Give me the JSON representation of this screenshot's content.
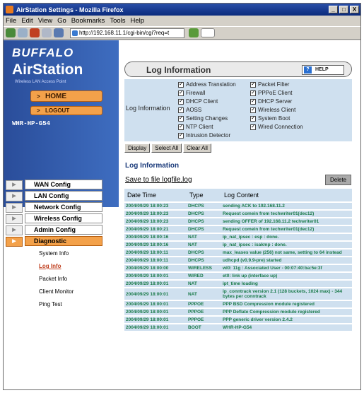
{
  "window": {
    "title": "AirStation Settings - Mozilla Firefox",
    "btn_min": "_",
    "btn_max": "□",
    "btn_close": "X"
  },
  "menu": [
    {
      "label": "File",
      "u": "F"
    },
    {
      "label": "Edit",
      "u": "E"
    },
    {
      "label": "View",
      "u": "V"
    },
    {
      "label": "Go",
      "u": "G"
    },
    {
      "label": "Bookmarks",
      "u": "B"
    },
    {
      "label": "Tools",
      "u": "T"
    },
    {
      "label": "Help",
      "u": "H"
    }
  ],
  "url": "http://192.168.11.1/cgi-bin/cgi?req=t",
  "brand": {
    "buffalo": "BUFFALO",
    "airstation": "AirStation",
    "tagline": "Wireless LAN Access Point",
    "model": "WHR-HP-G54"
  },
  "buttons": {
    "home": "HOME",
    "logout": "LOGOUT"
  },
  "nav": [
    "WAN Config",
    "LAN Config",
    "Network Config",
    "Wireless Config",
    "Admin Config",
    "Diagnostic"
  ],
  "subnav": [
    "System Info",
    "Log Info",
    "Packet Info",
    "Client Monitor",
    "Ping Test"
  ],
  "page": {
    "title": "Log Information",
    "help": "HELP",
    "log_label": "Log Information",
    "section_title": "Log Information",
    "save_link": "Save to file logfile.log",
    "delete": "Delete"
  },
  "filters_left": [
    "Address Translation",
    "Firewall",
    "DHCP Client",
    "AOSS",
    "Setting Changes",
    "NTP Client",
    "Intrusion Detector"
  ],
  "filters_right": [
    "Packet Filter",
    "PPPoE Client",
    "DHCP Server",
    "Wireless Client",
    "System Boot",
    "Wired Connection"
  ],
  "actions": [
    "Display",
    "Select All",
    "Clear All"
  ],
  "table": {
    "headers": [
      "Date Time",
      "Type",
      "Log Content"
    ],
    "rows": [
      [
        "2004/09/29 18:00:23",
        "DHCPS",
        "sending ACK to 192.168.11.2"
      ],
      [
        "2004/09/29 18:00:23",
        "DHCPS",
        "Request comein from techwriter01(dec12)"
      ],
      [
        "2004/09/29 18:00:23",
        "DHCPS",
        "sending OFFER of 192.168.11.2 techwriter01"
      ],
      [
        "2004/09/29 18:00:21",
        "DHCPS",
        "Request comein from techwriter01(dec12)"
      ],
      [
        "2004/09/29 18:00:16",
        "NAT",
        "ip_nat_ipsec : esp : done."
      ],
      [
        "2004/09/29 18:00:16",
        "NAT",
        "ip_nat_ipsec : isakmp : done."
      ],
      [
        "2004/09/29 18:00:11",
        "DHCPS",
        "max_leases value (256) not same, setting to 64 instead"
      ],
      [
        "2004/09/29 18:00:11",
        "DHCPS",
        "udhcpd (v0.9.9-pre) started"
      ],
      [
        "2004/09/29 18:00:00",
        "WIRELESS",
        "wl0: 11g : Associated User - 00:07:40:ba:5e:3f"
      ],
      [
        "2004/09/29 18:00:01",
        "WIRED",
        "et0: link up (interface up)"
      ],
      [
        "2004/09/29 18:00:01",
        "NAT",
        "ipt_time loading"
      ],
      [
        "2004/09/29 18:00:01",
        "NAT",
        "ip_conntrack version 2.1 (128 buckets, 1024 max) - 344 bytes per conntrack"
      ],
      [
        "2004/09/29 18:00:01",
        "PPPOE",
        "PPP BSD Compression module registered"
      ],
      [
        "2004/09/29 18:00:01",
        "PPPOE",
        "PPP Deflate Compression module registered"
      ],
      [
        "2004/09/29 18:00:01",
        "PPPOE",
        "PPP generic driver version 2.4.2"
      ],
      [
        "2004/09/29 18:00:01",
        "BOOT",
        "WHR-HP-G54"
      ]
    ]
  }
}
